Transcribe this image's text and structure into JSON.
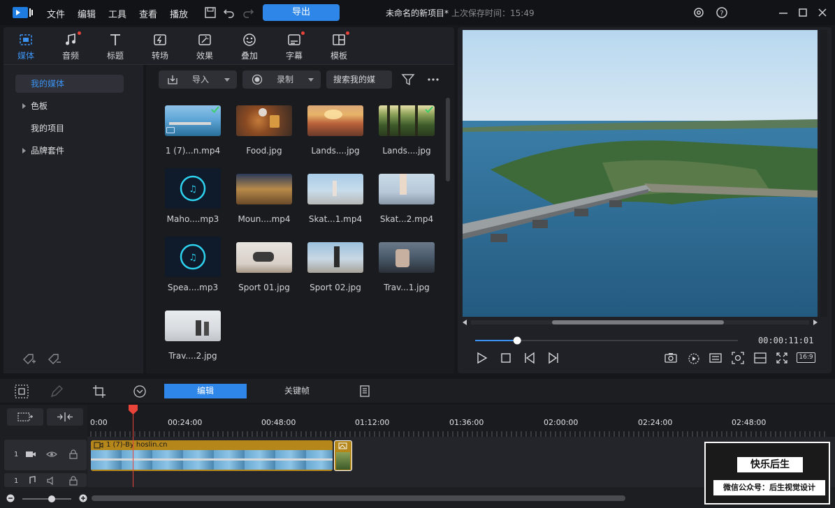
{
  "menu": {
    "file": "文件",
    "edit": "编辑",
    "tools": "工具",
    "view": "查看",
    "play": "播放"
  },
  "export_label": "导出",
  "project": {
    "title": "未命名的新项目*",
    "saved": "上次保存时间：15:49"
  },
  "lib_tabs": [
    {
      "label": "媒体",
      "icon": "media-icon",
      "active": true
    },
    {
      "label": "音频",
      "icon": "music-note-icon",
      "dot": true
    },
    {
      "label": "标题",
      "icon": "title-t-icon"
    },
    {
      "label": "转场",
      "icon": "transition-icon"
    },
    {
      "label": "效果",
      "icon": "effects-icon"
    },
    {
      "label": "叠加",
      "icon": "overlay-icon"
    },
    {
      "label": "字幕",
      "icon": "subtitle-icon",
      "dot": true
    },
    {
      "label": "模板",
      "icon": "template-icon",
      "dot": true
    }
  ],
  "sidebar": {
    "items": [
      "我的媒体",
      "色板",
      "我的项目",
      "品牌套件"
    ]
  },
  "toolbar": {
    "import_label": "导入",
    "record_label": "录制",
    "search_placeholder": "搜索我的媒"
  },
  "media": [
    {
      "label": "1 (7)...n.mp4",
      "checked": true
    },
    {
      "label": "Food.jpg"
    },
    {
      "label": "Lands....jpg"
    },
    {
      "label": "Lands....jpg",
      "checked": true
    },
    {
      "label": "Maho....mp3"
    },
    {
      "label": "Moun....mp4"
    },
    {
      "label": "Skat...1.mp4"
    },
    {
      "label": "Skat...2.mp4"
    },
    {
      "label": "Spea....mp3"
    },
    {
      "label": "Sport 01.jpg"
    },
    {
      "label": "Sport 02.jpg"
    },
    {
      "label": "Trav...1.jpg"
    },
    {
      "label": "Trav....2.jpg"
    }
  ],
  "preview": {
    "timecode": "00:00:11:01",
    "aspect": "16:9",
    "progress": 0.16
  },
  "timeline": {
    "edit_tab": "编辑",
    "keyframe_tab": "关键帧",
    "ticks": [
      "0:00",
      "00:24:00",
      "00:48:00",
      "01:12:00",
      "01:36:00",
      "02:00:00",
      "02:24:00",
      "02:48:00"
    ],
    "clip_title": "1 (7)-By hoslin.cn",
    "track1": "1",
    "track2": "1"
  },
  "watermark": {
    "title": "快乐后生",
    "subtitle": "微信公众号：后生视觉设计"
  }
}
